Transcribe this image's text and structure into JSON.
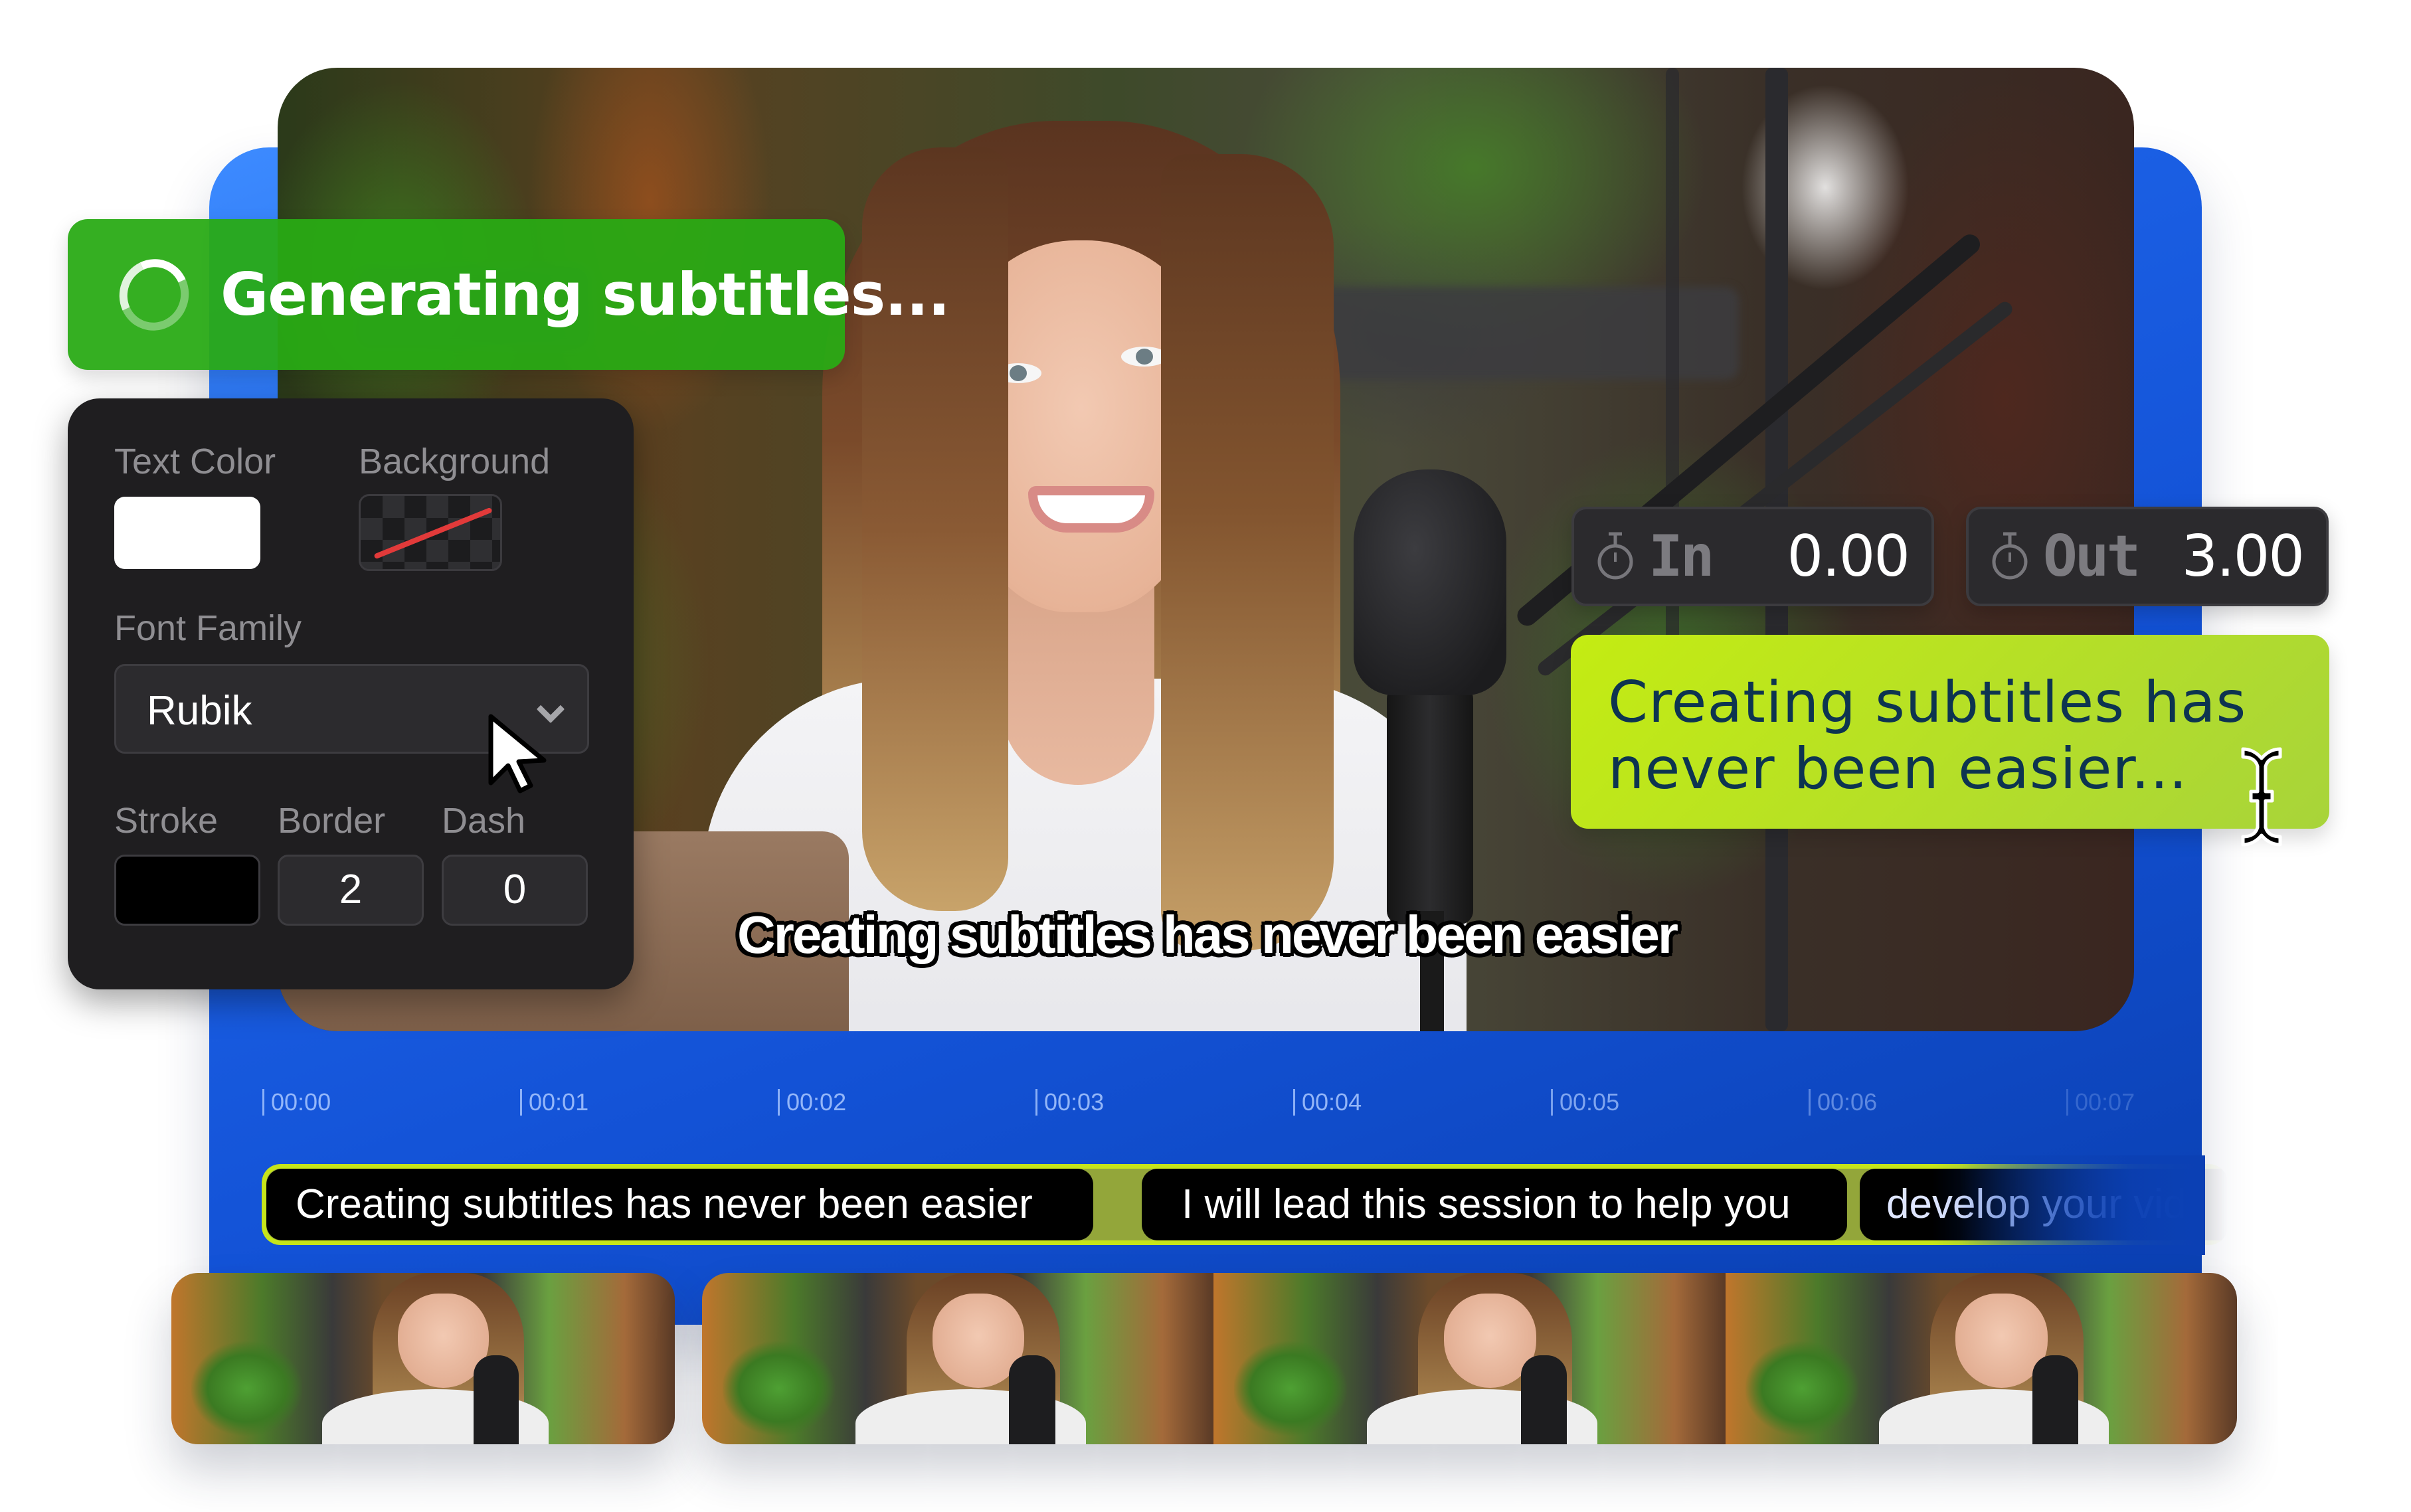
{
  "status_banner": {
    "icon": "loading-spinner-icon",
    "text": "Generating subtitles...",
    "color": "#2aaa14"
  },
  "style_panel": {
    "text_color": {
      "label": "Text Color",
      "value": "#ffffff"
    },
    "background": {
      "label": "Background",
      "value": "transparent"
    },
    "font_family": {
      "label": "Font Family",
      "value": "Rubik"
    },
    "stroke": {
      "label": "Stroke",
      "value": "#000000"
    },
    "border": {
      "label": "Border",
      "value": "2"
    },
    "dash": {
      "label": "Dash",
      "value": "0"
    }
  },
  "timing": {
    "in": {
      "icon": "stopwatch-icon",
      "label": "In",
      "value": "0.00"
    },
    "out": {
      "icon": "stopwatch-icon",
      "label": "Out",
      "value": "3.00"
    }
  },
  "subtitle_editor": {
    "text": "Creating subtitles has never been easier...",
    "color": "#c4ec12"
  },
  "video": {
    "subtitle_overlay": "Creating subtitles has never been easier"
  },
  "timeline": {
    "ticks": [
      "00:00",
      "00:01",
      "00:02",
      "00:03",
      "00:04",
      "00:05",
      "00:06",
      "00:07"
    ],
    "clips": [
      {
        "text": "Creating subtitles has never been easier",
        "selected": true
      },
      {
        "text": "I will lead this session to help you",
        "selected": false
      },
      {
        "text": "develop your vid",
        "selected": false
      }
    ],
    "accent": "#c6e51a"
  },
  "filmstrip": {
    "thumbnail_count": 4
  }
}
